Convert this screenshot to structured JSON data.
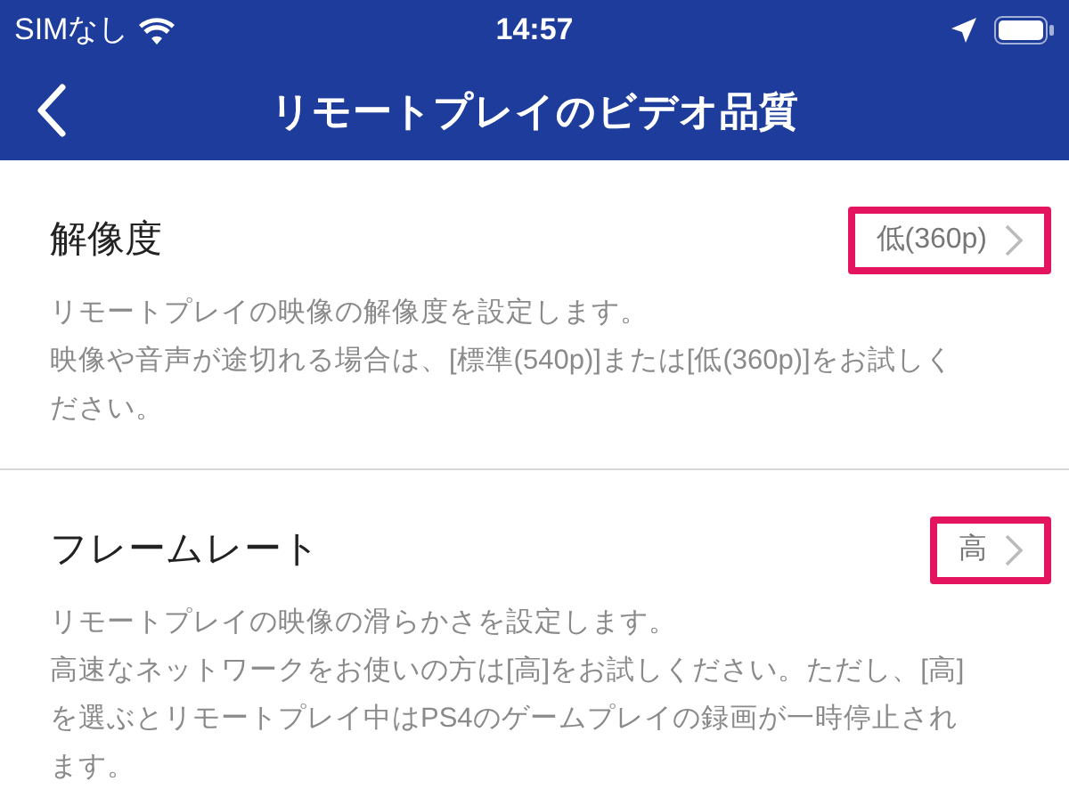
{
  "status_bar": {
    "carrier": "SIMなし",
    "time": "14:57"
  },
  "nav": {
    "title": "リモートプレイのビデオ品質"
  },
  "settings": [
    {
      "title": "解像度",
      "value": "低(360p)",
      "highlighted": true,
      "description": [
        "リモートプレイの映像の解像度を設定します。",
        "映像や音声が途切れる場合は、[標準(540p)]または[低(360p)]をお試しください。"
      ]
    },
    {
      "title": "フレームレート",
      "value": "高",
      "highlighted": true,
      "description": [
        "リモートプレイの映像の滑らかさを設定します。",
        "高速なネットワークをお使いの方は[高]をお試しください。ただし、[高]を選ぶとリモートプレイ中はPS4のゲームプレイの録画が一時停止されます。"
      ]
    }
  ]
}
